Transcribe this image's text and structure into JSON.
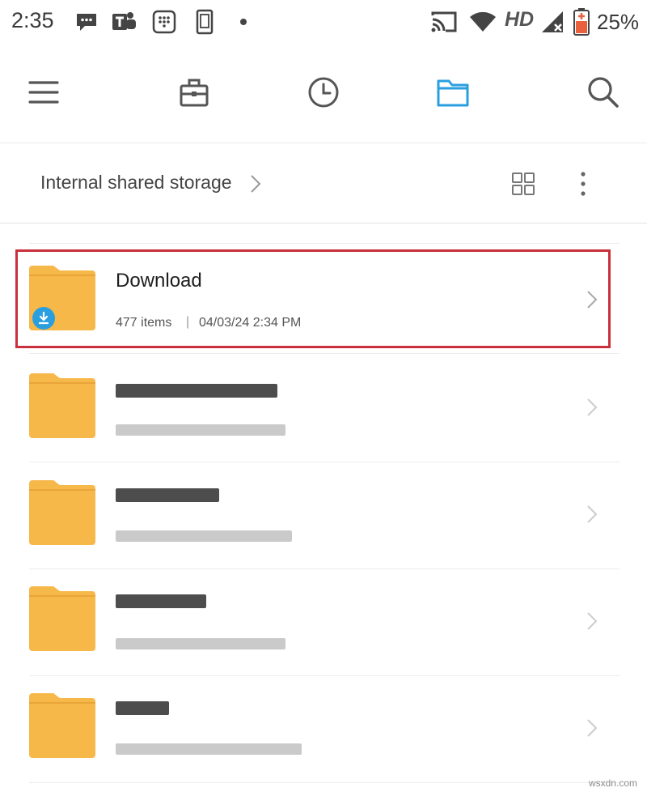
{
  "status_bar": {
    "time": "2:35",
    "network": "HD",
    "battery_percent": "25%",
    "icons": [
      "chat-bubble-icon",
      "teams-icon",
      "dialpad-icon",
      "phone-screen-icon",
      "dot-icon",
      "cast-icon",
      "wifi-icon",
      "signal-icon",
      "battery-icon"
    ]
  },
  "toolbar": {
    "buttons": [
      "menu-icon",
      "briefcase-icon",
      "recent-clock-icon",
      "folder-icon",
      "search-icon"
    ],
    "active": "folder-icon",
    "accent_color": "#2a9fe0"
  },
  "path_bar": {
    "location": "Internal shared storage",
    "icons": [
      "chevron-right-icon",
      "grid-view-icon",
      "more-vert-icon"
    ]
  },
  "files": [
    {
      "name": "Download",
      "item_count": "477 items",
      "separator": "|",
      "modified": "04/03/24 2:34 PM",
      "badge": "download-badge-icon",
      "highlighted": true
    },
    {
      "name": "",
      "item_count": "",
      "modified": "",
      "redacted": true
    },
    {
      "name": "",
      "item_count": "",
      "modified": "",
      "redacted": true
    },
    {
      "name": "",
      "item_count": "",
      "modified": "",
      "redacted": true
    },
    {
      "name": "",
      "item_count": "",
      "modified": "",
      "redacted": true
    }
  ],
  "colors": {
    "folder": "#f7b84a",
    "folder_tab": "#e9a53a",
    "highlight": "#c9303b",
    "badge": "#2a9fe0"
  },
  "watermark": "wsxdn.com"
}
